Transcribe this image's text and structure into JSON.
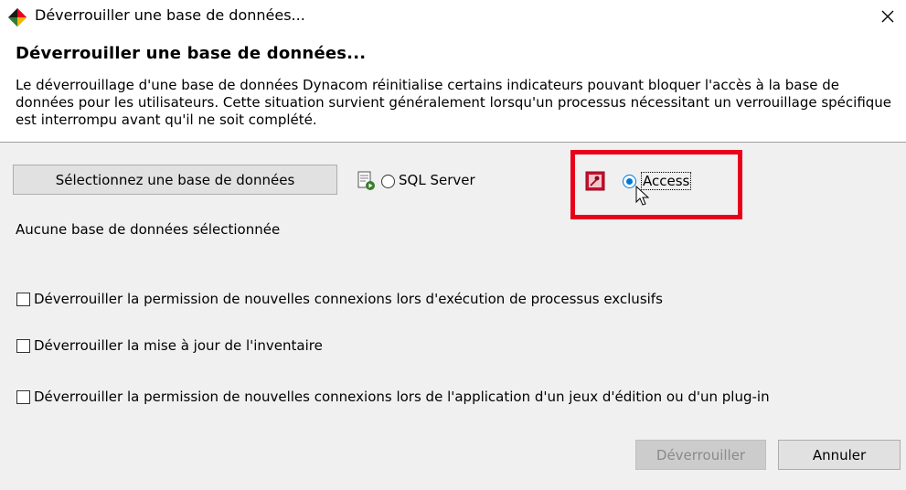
{
  "window": {
    "title": "Déverrouiller une base de données...",
    "close_icon": "close-icon"
  },
  "header": {
    "heading": "Déverrouiller une base de données...",
    "description": "Le déverrouillage d'une base de données Dynacom réinitialise certains indicateurs pouvant bloquer l'accès à la base de données pour les utilisateurs. Cette situation survient généralement lorsqu'un processus nécessitant un verrouillage spécifique est interrompu avant qu'il ne soit complété."
  },
  "database": {
    "select_button_label": "Sélectionnez une base de données",
    "types": [
      {
        "label": "SQL Server",
        "icon": "sql-server-icon",
        "selected": false
      },
      {
        "label": "Access",
        "icon": "access-icon",
        "selected": true
      }
    ],
    "status": "Aucune base de données sélectionnée"
  },
  "options": [
    {
      "label": "Déverrouiller la permission de nouvelles connexions lors d'exécution de processus exclusifs",
      "checked": false
    },
    {
      "label": "Déverrouiller la mise à jour de l'inventaire",
      "checked": false
    },
    {
      "label": "Déverrouiller la permission de nouvelles connexions lors de l'application d'un jeux d'édition ou d'un plug-in",
      "checked": false
    }
  ],
  "actions": {
    "unlock_label": "Déverrouiller",
    "unlock_enabled": false,
    "cancel_label": "Annuler"
  },
  "colors": {
    "highlight": "#e8001a",
    "radio_selected": "#0078d7",
    "dialog_background": "#f0f0f0"
  }
}
